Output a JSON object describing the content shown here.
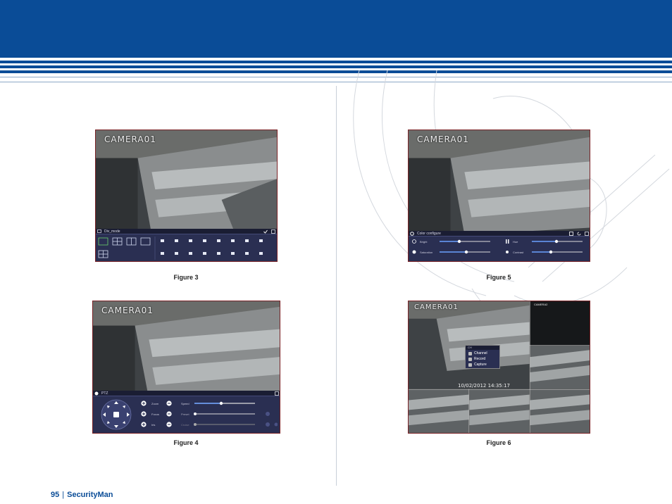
{
  "figures": {
    "fig3": {
      "caption": "Figure 3",
      "camera_label": "CAMERA01",
      "panel_title": "Div_mode"
    },
    "fig4": {
      "caption": "Figure 4",
      "camera_label": "CAMERA01",
      "panel_title": "PTZ",
      "labels": {
        "zoom": "Zoom",
        "focus": "Focus",
        "iris": "Iris",
        "speed": "Speed",
        "preset": "Preset",
        "cruise": "Cruise"
      }
    },
    "fig5": {
      "caption": "Figure 5",
      "camera_label": "CAMERA01",
      "panel_title": "Color configure",
      "labels": {
        "bright": "Bright",
        "hue": "Hue",
        "saturation": "Saturation",
        "contrast": "Contrast"
      }
    },
    "fig6": {
      "caption": "Figure 6",
      "camera_label": "CAMERA01",
      "tile_label": "CAMERA2",
      "timestamp": "10/02/2012 14:35:17",
      "menu": {
        "title": "CH",
        "items": [
          "Channel",
          "Record",
          "Capture"
        ]
      }
    }
  },
  "footer": {
    "page_number": "95",
    "brand": "SecurityMan"
  },
  "colors": {
    "header_blue": "#0a4c97",
    "panel_navy": "#2a2f52",
    "frame_red": "#7a2226"
  }
}
